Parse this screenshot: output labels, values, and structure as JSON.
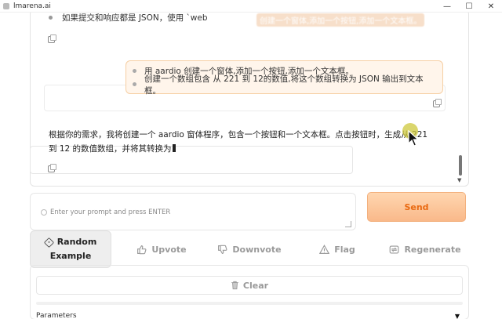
{
  "window": {
    "title": "lmarena.ai",
    "controls": {
      "minimize": "—",
      "maximize": "☐",
      "close": "✕"
    }
  },
  "chat": {
    "prev_message": "如果提交和响应都是 JSON，使用 `web",
    "overlay_text": "创建一个窗体,添加一个按钮,添加一个文本框。",
    "user_items": [
      "用 aardio 创建一个窗体,添加一个按钮,添加一个文本框。",
      "创建一个数组包含 从 221 到 12的数值,将这个数组转换为 JSON 输出到文本框。"
    ],
    "bot_reply": "根据你的需求，我将创建一个 aardio 窗体程序，包含一个按钮和一个文本框。点击按钮时，生成从 221 到 12 的数值数组，并将其转换为"
  },
  "input": {
    "placeholder": "Enter your prompt and press ENTER",
    "value": ""
  },
  "buttons": {
    "send": "Send",
    "random_line1": "Random",
    "random_line2": "Example",
    "upvote": "Upvote",
    "downvote": "Downvote",
    "flag": "Flag",
    "regenerate": "Regenerate",
    "clear": "Clear"
  },
  "params": {
    "label": "Parameters",
    "chevron": "▼"
  },
  "colors": {
    "accent": "#e96a12",
    "send_bg": "#f9b98a",
    "bubble_bg": "#fff5eb",
    "muted": "#9a9a9a"
  }
}
